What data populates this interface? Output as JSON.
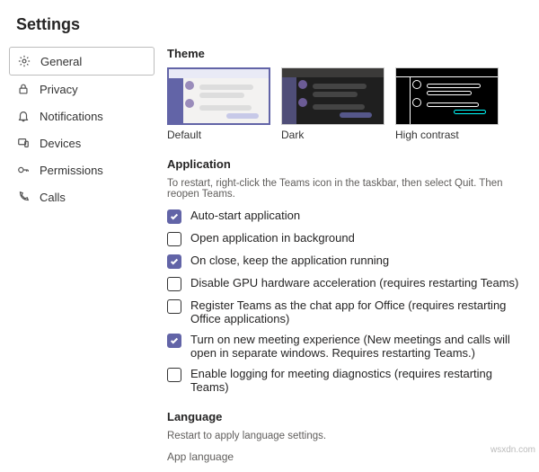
{
  "header": {
    "title": "Settings"
  },
  "sidebar": {
    "items": [
      {
        "label": "General"
      },
      {
        "label": "Privacy"
      },
      {
        "label": "Notifications"
      },
      {
        "label": "Devices"
      },
      {
        "label": "Permissions"
      },
      {
        "label": "Calls"
      }
    ]
  },
  "theme": {
    "title": "Theme",
    "options": [
      {
        "label": "Default"
      },
      {
        "label": "Dark"
      },
      {
        "label": "High contrast"
      }
    ]
  },
  "application": {
    "title": "Application",
    "hint": "To restart, right-click the Teams icon in the taskbar, then select Quit. Then reopen Teams.",
    "options": [
      {
        "label": "Auto-start application",
        "checked": true
      },
      {
        "label": "Open application in background",
        "checked": false
      },
      {
        "label": "On close, keep the application running",
        "checked": true
      },
      {
        "label": "Disable GPU hardware acceleration (requires restarting Teams)",
        "checked": false
      },
      {
        "label": "Register Teams as the chat app for Office (requires restarting Office applications)",
        "checked": false
      },
      {
        "label": "Turn on new meeting experience (New meetings and calls will open in separate windows. Requires restarting Teams.)",
        "checked": true
      },
      {
        "label": "Enable logging for meeting diagnostics (requires restarting Teams)",
        "checked": false
      }
    ]
  },
  "language": {
    "title": "Language",
    "hint": "Restart to apply language settings.",
    "appLanguageLabel": "App language"
  },
  "watermark": "wsxdn.com"
}
